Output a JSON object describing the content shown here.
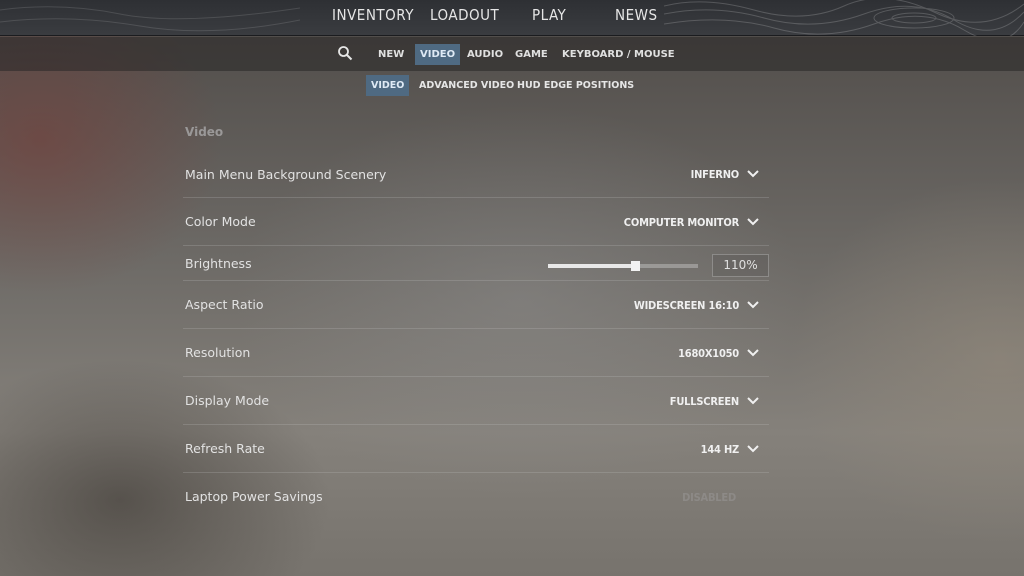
{
  "top_nav": {
    "items": [
      "INVENTORY",
      "LOADOUT",
      "PLAY",
      "NEWS"
    ]
  },
  "settings_tabs": {
    "search_icon": "search-icon",
    "items": [
      "NEW",
      "VIDEO",
      "AUDIO",
      "GAME",
      "KEYBOARD / MOUSE"
    ],
    "active": "VIDEO"
  },
  "video_subtabs": {
    "items": [
      "VIDEO",
      "ADVANCED VIDEO",
      "HUD EDGE POSITIONS"
    ],
    "active": "VIDEO"
  },
  "section": {
    "title": "Video"
  },
  "settings": {
    "main_menu_background": {
      "label": "Main Menu Background Scenery",
      "value": "INFERNO"
    },
    "color_mode": {
      "label": "Color Mode",
      "value": "COMPUTER MONITOR"
    },
    "brightness": {
      "label": "Brightness",
      "value": "110%",
      "slider_fraction": 0.58
    },
    "aspect_ratio": {
      "label": "Aspect Ratio",
      "value": "WIDESCREEN 16:10"
    },
    "resolution": {
      "label": "Resolution",
      "value": "1680X1050"
    },
    "display_mode": {
      "label": "Display Mode",
      "value": "FULLSCREEN"
    },
    "refresh_rate": {
      "label": "Refresh Rate",
      "value": "144 HZ"
    },
    "laptop_power_savings": {
      "label": "Laptop Power Savings",
      "value": "DISABLED",
      "enabled": false
    }
  },
  "colors": {
    "active_tab": "#4f6a82",
    "top_bar": "#35373b"
  }
}
